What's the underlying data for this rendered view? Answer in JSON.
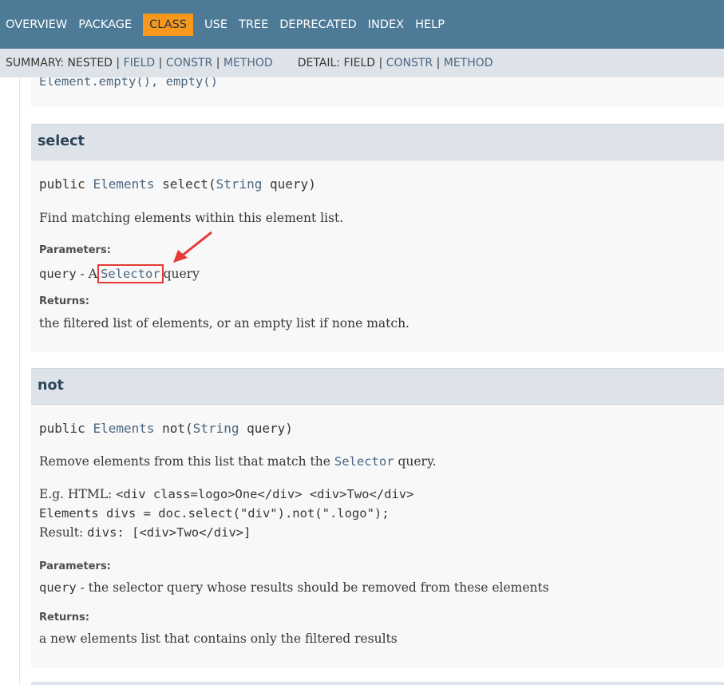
{
  "topnav": {
    "items": [
      "OVERVIEW",
      "PACKAGE",
      "CLASS",
      "USE",
      "TREE",
      "DEPRECATED",
      "INDEX",
      "HELP"
    ],
    "active": "CLASS"
  },
  "subnav": {
    "summary_label": "SUMMARY: NESTED",
    "summary_field": "FIELD",
    "summary_constr": "CONSTR",
    "summary_method": "METHOD",
    "detail_label": "DETAIL: FIELD",
    "detail_constr": "CONSTR",
    "detail_method": "METHOD",
    "separator": "|"
  },
  "clipped_prev": {
    "text": "Element.empty(), empty()"
  },
  "select_method": {
    "name": "select",
    "sig_modifier": "public",
    "sig_return": "Elements",
    "sig_name": "select",
    "sig_param_type": "String",
    "sig_param_name": "query",
    "description": "Find matching elements within this element list.",
    "params_label": "Parameters:",
    "param_name": "query",
    "param_desc_prefix": "- A",
    "param_link": "Selector",
    "param_desc_suffix": "query",
    "returns_label": "Returns:",
    "returns_desc": "the filtered list of elements, or an empty list if none match."
  },
  "not_method": {
    "name": "not",
    "sig_modifier": "public",
    "sig_return": "Elements",
    "sig_name": "not",
    "sig_param_type": "String",
    "sig_param_name": "query",
    "desc_prefix": "Remove elements from this list that match the",
    "desc_link": "Selector",
    "desc_suffix": "query.",
    "eg_prefix": "E.g. HTML:",
    "eg_html": "<div class=logo>One</div> <div>Two</div>",
    "eg_code": "Elements divs = doc.select(\"div\").not(\".logo\");",
    "result_prefix": "Result:",
    "result_code": "divs: [<div>Two</div>]",
    "params_label": "Parameters:",
    "param_name": "query",
    "param_desc": "- the selector query whose results should be removed from these elements",
    "returns_label": "Returns:",
    "returns_desc": "a new elements list that contains only the filtered results"
  },
  "colors": {
    "nav_bg": "#4D7A97",
    "nav_active": "#F8981D",
    "subnav_bg": "#DEE3E9",
    "link": "#4A6782",
    "highlight": "#e53935"
  }
}
